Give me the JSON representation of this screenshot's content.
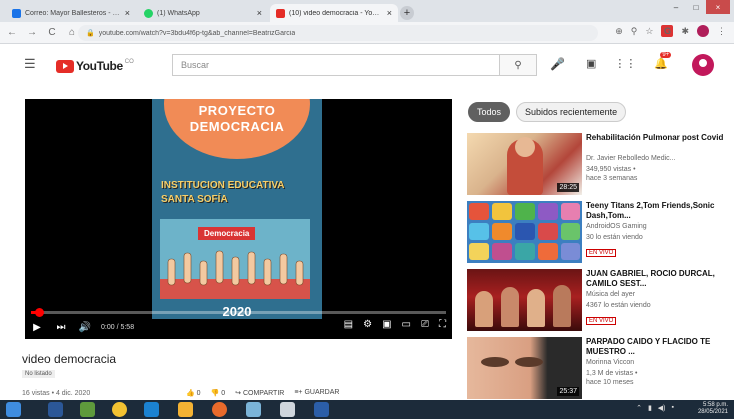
{
  "browser": {
    "tabs": [
      {
        "label": "Correo: Mayor Ballesteros - Out"
      },
      {
        "label": "(1) WhatsApp"
      },
      {
        "label": "(10) video democracia - YouTube"
      }
    ],
    "new_tab": "+",
    "url": "youtube.com/watch?v=3bdu4f6p-tg&ab_channel=BeatrizGarcia",
    "colors": {
      "tab_yt": "#e52d27",
      "tab_wa": "#25d366",
      "tab_mail": "#1a73e8"
    }
  },
  "youtube": {
    "logo_text": "YouTube",
    "logo_country": "CO",
    "search_placeholder": "Buscar",
    "notification_count": "9+"
  },
  "player": {
    "art_title": "PROYECTO DEMOCRACIA",
    "art_institution_line1": "INSTITUCION EDUCATIVA",
    "art_institution_line2": "SANTA SOFÍA",
    "art_label": "Democracia",
    "art_year": "2020",
    "time": "0:00 / 5:58",
    "progress_fraction": 0.02
  },
  "video": {
    "title": "video democracia",
    "tag": "No listado",
    "meta": "16 vistas • 4 dic. 2020",
    "likes": "0",
    "dislikes": "0",
    "share": "COMPARTIR",
    "save": "GUARDAR"
  },
  "sidebar": {
    "chips": [
      {
        "label": "Todos",
        "active": true
      },
      {
        "label": "Subidos recientemente",
        "active": false
      }
    ],
    "recommendations": [
      {
        "title": "Rehabilitación Pulmonar post Covid",
        "channel": "Dr. Javier Rebolledo Medic...",
        "stats": "349,950 vistas •",
        "age": "hace 3 semanas",
        "duration": "28:25",
        "live": ""
      },
      {
        "title": "Teeny Titans 2,Tom Friends,Sonic Dash,Tom...",
        "channel": "AndroidOS Gaming",
        "stats": "30 lo están viendo",
        "age": "",
        "duration": "",
        "live": "EN VIVO"
      },
      {
        "title": "JUAN GABRIEL, ROCIO DURCAL, CAMILO SEST...",
        "channel": "Música del ayer",
        "stats": "4367 lo están viendo",
        "age": "",
        "duration": "",
        "live": "EN VIVO"
      },
      {
        "title": "PARPADO CAIDO Y FLACIDO TE MUESTRO ...",
        "channel": "Morinna Viccon",
        "stats": "1,3 M de vistas •",
        "age": "hace 10 meses",
        "duration": "25:37",
        "live": ""
      }
    ]
  },
  "taskbar": {
    "time": "5:58 p.m.",
    "date": "28/05/2021"
  }
}
